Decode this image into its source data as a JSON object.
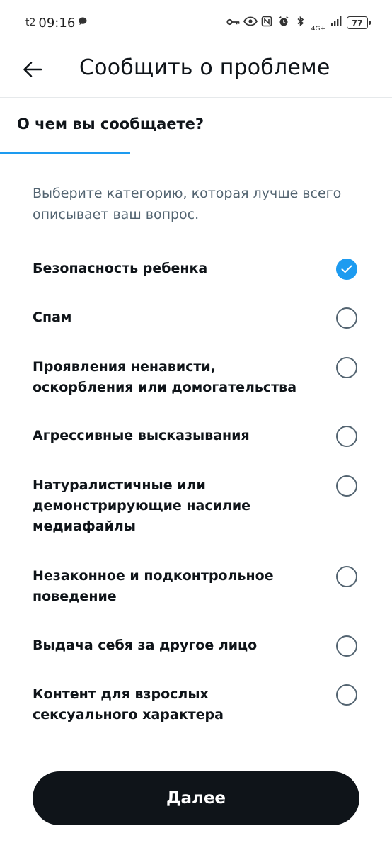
{
  "status_bar": {
    "carrier": "t2",
    "time": "09:16",
    "network": "4G+",
    "battery": "77"
  },
  "header": {
    "title": "Сообщить о проблеме"
  },
  "tab": {
    "label": "О чем вы сообщаете?"
  },
  "description": "Выберите категорию, которая лучше всего описывает ваш вопрос.",
  "options": [
    {
      "label": "Безопасность ребенка",
      "selected": true
    },
    {
      "label": "Спам",
      "selected": false
    },
    {
      "label": "Проявления ненависти, оскорбления или домогательства",
      "selected": false
    },
    {
      "label": "Агрессивные высказывания",
      "selected": false
    },
    {
      "label": "Натуралистичные или демонстрирующие насилие медиафайлы",
      "selected": false
    },
    {
      "label": "Незаконное и подконтрольное поведение",
      "selected": false
    },
    {
      "label": "Выдача себя за другое лицо",
      "selected": false
    },
    {
      "label": "Контент для взрослых сексуального характера",
      "selected": false
    }
  ],
  "next_button": {
    "label": "Далее"
  },
  "colors": {
    "accent": "#1d9bf0",
    "text_primary": "#0f1419",
    "text_secondary": "#536471",
    "button_bg": "#0f1419"
  }
}
